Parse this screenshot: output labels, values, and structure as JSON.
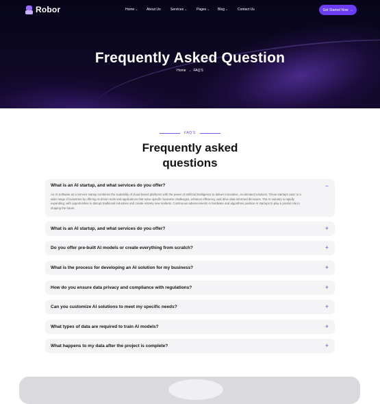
{
  "brand": {
    "name": "Robor",
    "accent": "#6a3df3"
  },
  "nav": {
    "items": [
      {
        "label": "Home",
        "dropdown": true
      },
      {
        "label": "About Us",
        "dropdown": false
      },
      {
        "label": "Services",
        "dropdown": true
      },
      {
        "label": "Pages",
        "dropdown": true
      },
      {
        "label": "Blog",
        "dropdown": true
      },
      {
        "label": "Contact Us",
        "dropdown": false
      }
    ],
    "cta_label": "Get Started Now"
  },
  "hero": {
    "title": "Frequently Asked Question",
    "breadcrumb": {
      "home": "Home",
      "separator": "→",
      "current": "FAQ'S"
    }
  },
  "section": {
    "tag": "FAQ'S",
    "title_line1": "Frequently asked",
    "title_line2": "questions"
  },
  "faqs": [
    {
      "question": "What is an AI startup, and what services do you offer?",
      "expanded": true,
      "answer": "An AI Software as a Service startup combines the scalability of cloud-based platforms with the power of artificial intelligence to deliver innovative, on-demand solutions. These startups cater to a wide range of industries by offering AI-driven tools and applications that solve specific business challenges, enhance efficiency, and drive data-informed decisions. The AI industry is rapidly expanding, with opportunities to disrupt traditional industries and create entirely new markets. Continuous advancements in hardware and algorithms position AI startups to play a pivotal role in shaping the future."
    },
    {
      "question": "What is an AI startup, and what services do you offer?",
      "expanded": false
    },
    {
      "question": "Do you offer pre-built AI models or create everything from scratch?",
      "expanded": false
    },
    {
      "question": "What is the process for developing an AI solution for my business?",
      "expanded": false
    },
    {
      "question": "How do you ensure data privacy and compliance with regulations?",
      "expanded": false
    },
    {
      "question": "Can you customize AI solutions to meet my specific needs?",
      "expanded": false
    },
    {
      "question": "What types of data are required to train AI models?",
      "expanded": false
    },
    {
      "question": "What happens to my data after the project is complete?",
      "expanded": false
    }
  ],
  "icons": {
    "expanded": "−",
    "collapsed": "+",
    "chevron": "⌄",
    "arrow": "→"
  }
}
